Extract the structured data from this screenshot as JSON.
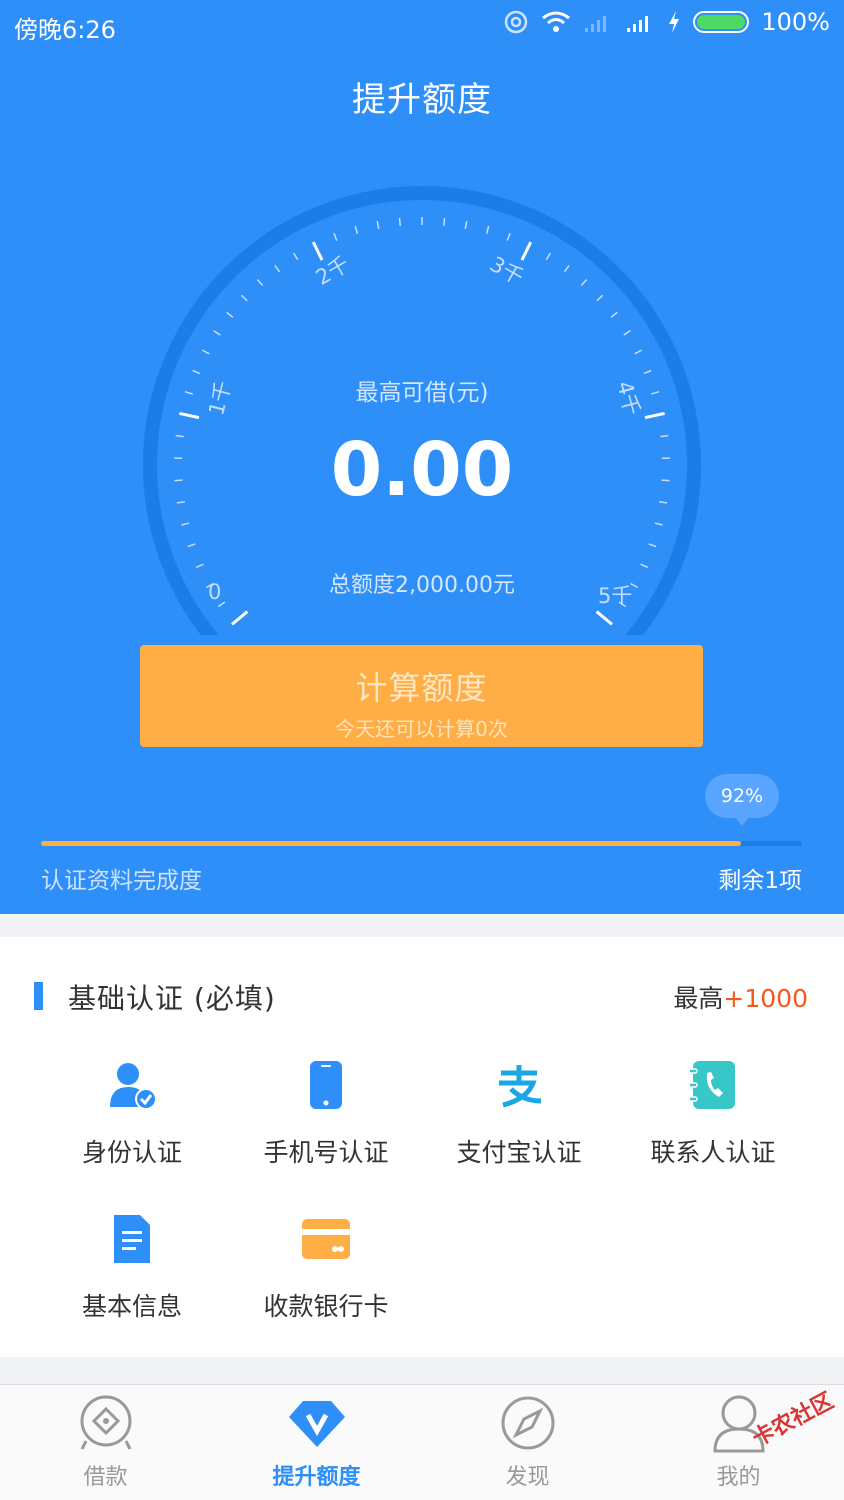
{
  "status": {
    "time": "傍晚6:26",
    "battery": "100%"
  },
  "title": "提升额度",
  "gauge": {
    "caption": "最高可借(元)",
    "amount": "0.00",
    "total": "总额度2,000.00元",
    "scale": [
      "0",
      "1千",
      "2千",
      "3千",
      "4千",
      "5千"
    ]
  },
  "calc": {
    "title": "计算额度",
    "subtitle": "今天还可以计算0次"
  },
  "progress": {
    "percent_label": "92%",
    "fraction": 0.92,
    "label": "认证资料完成度",
    "remaining": "剩余1项"
  },
  "section": {
    "title": "基础认证 (必填)",
    "max_prefix": "最高",
    "max_value": "+1000",
    "items": [
      {
        "label": "身份认证",
        "icon": "id-user-icon"
      },
      {
        "label": "手机号认证",
        "icon": "phone-icon"
      },
      {
        "label": "支付宝认证",
        "icon": "alipay-icon"
      },
      {
        "label": "联系人认证",
        "icon": "contacts-icon"
      },
      {
        "label": "基本信息",
        "icon": "document-icon"
      },
      {
        "label": "收款银行卡",
        "icon": "bank-card-icon"
      }
    ]
  },
  "tabs": [
    {
      "label": "借款",
      "icon": "loan-icon"
    },
    {
      "label": "提升额度",
      "icon": "diamond-v-icon"
    },
    {
      "label": "发现",
      "icon": "compass-icon"
    },
    {
      "label": "我的",
      "icon": "profile-icon"
    }
  ],
  "watermark": "卡农社区",
  "colors": {
    "primary": "#2d8ff7",
    "button": "#ffad45",
    "accent_red": "#f5581c",
    "icon_teal": "#38c7c9"
  }
}
